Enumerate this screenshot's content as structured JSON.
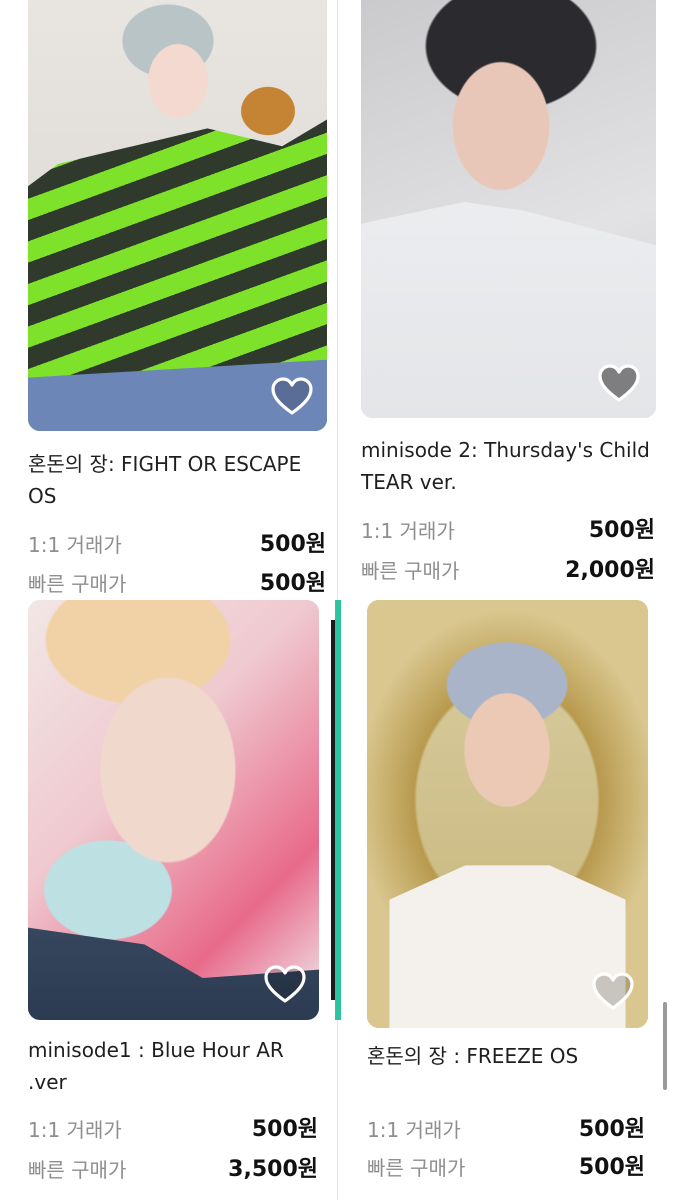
{
  "cards": [
    {
      "title": "혼돈의 장: FIGHT OR ESCAPE OS",
      "trade_label": "1:1 거래가",
      "trade_price": "500원",
      "quick_label": "빠른 구매가",
      "quick_price": "500원"
    },
    {
      "title": "minisode 2: Thursday's Child TEAR ver.",
      "trade_label": "1:1 거래가",
      "trade_price": "500원",
      "quick_label": "빠른 구매가",
      "quick_price": "2,000원"
    },
    {
      "title": "minisode1 : Blue Hour AR .ver",
      "trade_label": "1:1 거래가",
      "trade_price": "500원",
      "quick_label": "빠른 구매가",
      "quick_price": "3,500원"
    },
    {
      "title": "혼돈의 장 : FREEZE OS",
      "trade_label": "1:1 거래가",
      "trade_price": "500원",
      "quick_label": "빠른 구매가",
      "quick_price": "500원"
    }
  ],
  "icons": {
    "favorite": "heart-outline-icon"
  },
  "colors": {
    "price_label": "#8e8e8e",
    "price_value": "#111111"
  }
}
